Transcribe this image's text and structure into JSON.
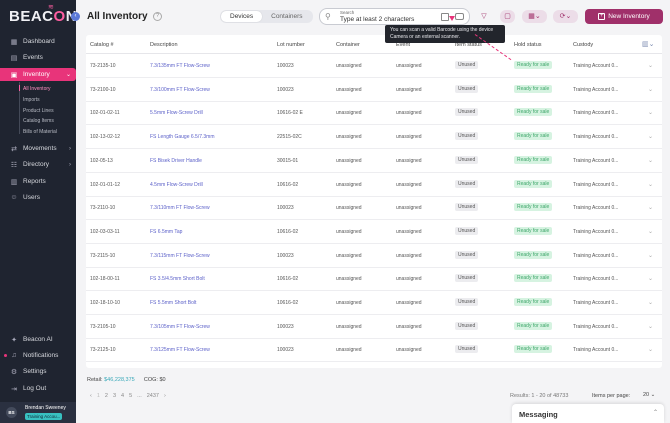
{
  "app": {
    "logo": "BEACON",
    "logo_o": "O"
  },
  "sidebar": {
    "items": [
      {
        "label": "Dashboard",
        "icon": "dashboard-icon"
      },
      {
        "label": "Events",
        "icon": "calendar-icon"
      },
      {
        "label": "Inventory",
        "icon": "inventory-icon",
        "active": true
      },
      {
        "label": "Movements",
        "icon": "movements-icon"
      },
      {
        "label": "Directory",
        "icon": "directory-icon"
      },
      {
        "label": "Reports",
        "icon": "reports-icon"
      },
      {
        "label": "Users",
        "icon": "users-icon"
      }
    ],
    "sub_items": [
      "All Inventory",
      "Imports",
      "Product Lines",
      "Catalog Items",
      "Bills of Material"
    ],
    "bottom_items": [
      {
        "label": "Beacon AI",
        "icon": "ai-icon"
      },
      {
        "label": "Notifications",
        "icon": "bell-icon"
      },
      {
        "label": "Settings",
        "icon": "gear-icon"
      },
      {
        "label": "Log Out",
        "icon": "logout-icon"
      }
    ],
    "user": {
      "initials": "BS",
      "name": "Brendan Sweeney",
      "badge": "Training Accou..."
    }
  },
  "header": {
    "title": "All Inventory",
    "help": "?",
    "tabs": [
      "Devices",
      "Containers"
    ],
    "search_label": "Search",
    "search_placeholder": "Type at least 2 characters",
    "tooltip": "You can scan a valid Barcode using the device Camera or an external scanner.",
    "new_button": "New Inventory"
  },
  "table": {
    "columns": [
      "Catalog #",
      "Description",
      "Lot number",
      "Container",
      "Event",
      "Item status",
      "Hold status",
      "Custody"
    ],
    "rows": [
      {
        "catalog": "73-2135-10",
        "desc": "7.3/135mm FT Flow-Screw",
        "lot": "100023",
        "container": "unassigned",
        "event": "unassigned",
        "item": "Unused",
        "hold": "Ready for sale",
        "custody": "Training Account 0..."
      },
      {
        "catalog": "73-2100-10",
        "desc": "7.3/100mm FT Flow-Screw",
        "lot": "100023",
        "container": "unassigned",
        "event": "unassigned",
        "item": "Unused",
        "hold": "Ready for sale",
        "custody": "Training Account 0..."
      },
      {
        "catalog": "102-01-02-11",
        "desc": "5.5mm Flow-Screw Drill",
        "lot": "10616-02 E",
        "container": "unassigned",
        "event": "unassigned",
        "item": "Unused",
        "hold": "Ready for sale",
        "custody": "Training Account 0..."
      },
      {
        "catalog": "102-13-02-12",
        "desc": "FS Length Gauge 6.5/7.3mm",
        "lot": "22515-02C",
        "container": "unassigned",
        "event": "unassigned",
        "item": "Unused",
        "hold": "Ready for sale",
        "custody": "Training Account 0..."
      },
      {
        "catalog": "102-05-13",
        "desc": "FS Bisek Driver Handle",
        "lot": "30015-01",
        "container": "unassigned",
        "event": "unassigned",
        "item": "Unused",
        "hold": "Ready for sale",
        "custody": "Training Account 0..."
      },
      {
        "catalog": "102-01-01-12",
        "desc": "4.5mm Flow-Screw Drill",
        "lot": "10616-02",
        "container": "unassigned",
        "event": "unassigned",
        "item": "Unused",
        "hold": "Ready for sale",
        "custody": "Training Account 0..."
      },
      {
        "catalog": "73-2110-10",
        "desc": "7.3/110mm FT Flow-Screw",
        "lot": "100023",
        "container": "unassigned",
        "event": "unassigned",
        "item": "Unused",
        "hold": "Ready for sale",
        "custody": "Training Account 0..."
      },
      {
        "catalog": "102-03-03-11",
        "desc": "FS 6.5mm Tap",
        "lot": "10616-02",
        "container": "unassigned",
        "event": "unassigned",
        "item": "Unused",
        "hold": "Ready for sale",
        "custody": "Training Account 0..."
      },
      {
        "catalog": "73-2115-10",
        "desc": "7.3/115mm FT Flow-Screw",
        "lot": "100023",
        "container": "unassigned",
        "event": "unassigned",
        "item": "Unused",
        "hold": "Ready for sale",
        "custody": "Training Account 0..."
      },
      {
        "catalog": "102-18-00-11",
        "desc": "FS 3.5/4.5mm Short Bolt",
        "lot": "10616-02",
        "container": "unassigned",
        "event": "unassigned",
        "item": "Unused",
        "hold": "Ready for sale",
        "custody": "Training Account 0..."
      },
      {
        "catalog": "102-18-10-10",
        "desc": "FS 5.5mm Short Bolt",
        "lot": "10616-02",
        "container": "unassigned",
        "event": "unassigned",
        "item": "Unused",
        "hold": "Ready for sale",
        "custody": "Training Account 0..."
      },
      {
        "catalog": "73-2105-10",
        "desc": "7.3/105mm FT Flow-Screw",
        "lot": "100023",
        "container": "unassigned",
        "event": "unassigned",
        "item": "Unused",
        "hold": "Ready for sale",
        "custody": "Training Account 0..."
      },
      {
        "catalog": "73-2125-10",
        "desc": "7.3/125mm FT Flow-Screw",
        "lot": "100023",
        "container": "unassigned",
        "event": "unassigned",
        "item": "Unused",
        "hold": "Ready for sale",
        "custody": "Training Account 0..."
      }
    ]
  },
  "footer": {
    "retail_label": "Retail:",
    "retail_value": "$46,228,375",
    "cog_label": "COG:",
    "cog_value": "$0",
    "pages": [
      "‹",
      "1",
      "2",
      "3",
      "4",
      "5",
      "...",
      "2437",
      "›"
    ],
    "results": "Results: 1 - 20 of 48733",
    "ipp_label": "Items per page:",
    "ipp_value": "20"
  },
  "messaging": {
    "title": "Messaging"
  },
  "colors": {
    "accent": "#e8347a",
    "brand": "#a0306a",
    "sidebar": "#1f2430",
    "ready": "#3ea66a"
  }
}
